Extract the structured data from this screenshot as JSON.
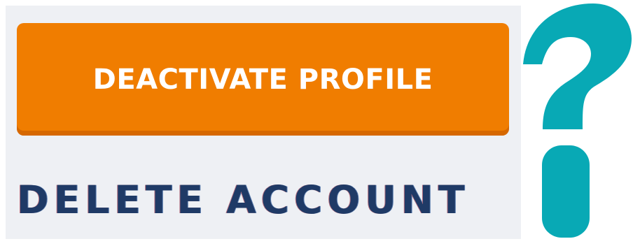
{
  "actions": {
    "deactivate_label": "DEACTIVATE PROFILE",
    "delete_label": "DELETE ACCOUNT"
  },
  "icons": {
    "decorative": "question-mark-icon"
  },
  "colors": {
    "deactivate_button": "#f07d00",
    "deactivate_button_shadow": "#d66800",
    "delete_text": "#1f3a66",
    "panel_background": "#eef0f4",
    "question_mark": "#08a9b5"
  }
}
